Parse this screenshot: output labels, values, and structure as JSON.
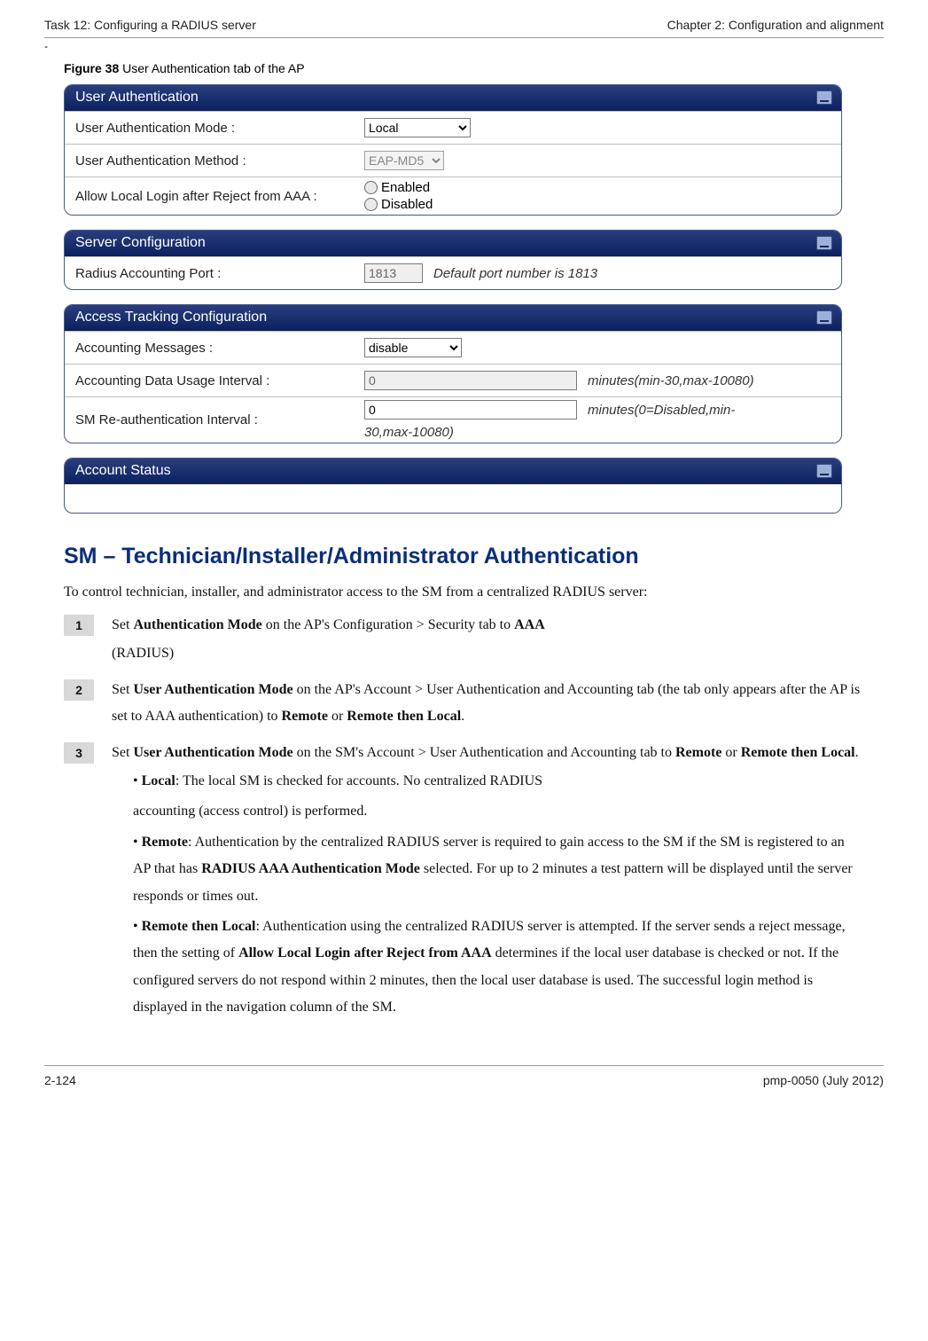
{
  "header": {
    "left": "Task 12: Configuring a RADIUS server",
    "right": "Chapter 2:  Configuration and alignment"
  },
  "dash": "-",
  "figure": {
    "label": "Figure 38",
    "caption": "  User Authentication tab of the AP"
  },
  "ui": {
    "panel1": {
      "title": "User Authentication",
      "row1": {
        "label": "User Authentication Mode :",
        "value": "Local"
      },
      "row2": {
        "label": "User Authentication Method :",
        "value": "EAP-MD5"
      },
      "row3": {
        "label": "Allow Local Login after Reject from AAA :",
        "opt1": "Enabled",
        "opt2": "Disabled"
      }
    },
    "panel2": {
      "title": "Server Configuration",
      "row1": {
        "label": "Radius Accounting Port :",
        "value": "1813",
        "hint": "Default port number is 1813"
      }
    },
    "panel3": {
      "title": "Access Tracking Configuration",
      "row1": {
        "label": "Accounting Messages :",
        "value": "disable"
      },
      "row2": {
        "label": "Accounting Data Usage Interval :",
        "value": "0",
        "hint": "minutes(min-30,max-10080)"
      },
      "row3": {
        "label": "SM Re-authentication Interval :",
        "value": "0",
        "hint": "minutes(0=Disabled,min-",
        "hint2": "30,max-10080)"
      }
    },
    "panel4": {
      "title": "Account Status"
    }
  },
  "section": {
    "heading": "SM – Technician/Installer/Administrator Authentication",
    "intro": "To control technician, installer, and administrator access to the SM from a centralized RADIUS server:"
  },
  "steps": {
    "s1": {
      "num": "1",
      "t1a": "Set ",
      "t1b": "Authentication Mode",
      "t1c": " on the AP's Configuration > Security tab to ",
      "t1d": "AAA",
      "t2": "(RADIUS)"
    },
    "s2": {
      "num": "2",
      "t1a": "Set ",
      "t1b": "User Authentication Mode",
      "t1c": " on the AP's Account > User Authentication and Accounting tab (the tab only appears after the AP is set to AAA authentication) to ",
      "t1d": "Remote",
      "t1e": " or ",
      "t1f": "Remote then Local",
      "t1g": "."
    },
    "s3": {
      "num": "3",
      "t1a": "Set ",
      "t1b": "User Authentication Mode",
      "t1c": " on the SM's Account > User Authentication and Accounting tab to ",
      "t1d": "Remote",
      "t1e": " or ",
      "t1f": "Remote then Local",
      "t1g": ".",
      "b1a": "•   ",
      "b1b": "Local",
      "b1c": ": The local SM is checked for accounts. No centralized RADIUS",
      "b1d": "accounting (access control) is performed.",
      "b2a": "•   ",
      "b2b": "Remote",
      "b2c": ": Authentication by the centralized RADIUS server is required to gain access to the SM if the SM is registered to an AP that has ",
      "b2d": "RADIUS AAA Authentication Mode",
      "b2e": " selected. For up to 2 minutes a test pattern will be displayed until the server responds or times out.",
      "b3a": "•   ",
      "b3b": "Remote then Local",
      "b3c": ": Authentication using the centralized RADIUS server is attempted. If the server sends a reject message, then the setting of ",
      "b3d": "Allow Local Login after Reject from AAA",
      "b3e": " determines if the local user database is checked or not. If the configured servers do not respond within 2 minutes, then the local user database is used. The successful login method is displayed in the navigation column of the SM."
    }
  },
  "footer": {
    "left": "2-124",
    "right": "pmp-0050 (July 2012)"
  }
}
